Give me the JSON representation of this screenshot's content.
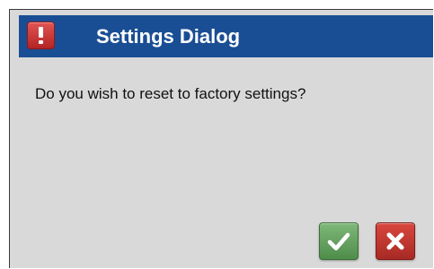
{
  "dialog": {
    "title": "Settings Dialog",
    "title_icon": "exclamation-icon",
    "message": "Do you wish to reset to factory settings?"
  },
  "buttons": {
    "confirm_icon": "checkmark-icon",
    "cancel_icon": "close-icon"
  },
  "colors": {
    "titlebar": "#1a4e94",
    "dialog_background": "#d9d9d9",
    "confirm_button": "#5f9d5a",
    "cancel_button": "#c0362f",
    "alert_icon": "#c93232"
  }
}
